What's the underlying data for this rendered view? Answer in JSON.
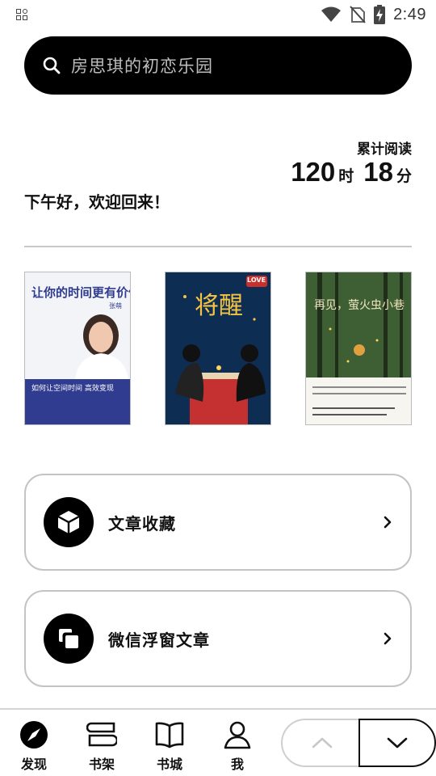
{
  "status_bar": {
    "time": "2:49",
    "icons": [
      "notification-grid-icon",
      "wifi-icon",
      "no-sim-icon",
      "battery-charging-icon"
    ]
  },
  "search": {
    "text": "房思琪的初恋乐园",
    "icon": "search-icon"
  },
  "reading": {
    "label": "累计阅读",
    "hours": "120",
    "hours_unit": "时",
    "minutes": "18",
    "minutes_unit": "分"
  },
  "greeting": "下午好，欢迎回来！",
  "books": [
    {
      "title": "让你的时间更有价值",
      "subtitle": "如何让空间时间 高效变现",
      "author": "张萌"
    },
    {
      "title": "将醒",
      "tag": "LOVE"
    },
    {
      "title": "再见，萤火虫小巷"
    }
  ],
  "cards": [
    {
      "label": "文章收藏",
      "icon": "cube-icon"
    },
    {
      "label": "微信浮窗文章",
      "icon": "floating-window-icon"
    }
  ],
  "nav": {
    "items": [
      {
        "label": "发现",
        "icon": "compass-icon"
      },
      {
        "label": "书架",
        "icon": "bookshelf-icon"
      },
      {
        "label": "书城",
        "icon": "open-book-icon"
      },
      {
        "label": "我",
        "icon": "person-icon"
      }
    ],
    "page_up_icon": "chevron-up-icon",
    "page_down_icon": "chevron-down-icon"
  },
  "colors": {
    "primary": "#000000",
    "background": "#ffffff",
    "border": "#c4c4c4",
    "search_text": "#bdbdbd"
  }
}
